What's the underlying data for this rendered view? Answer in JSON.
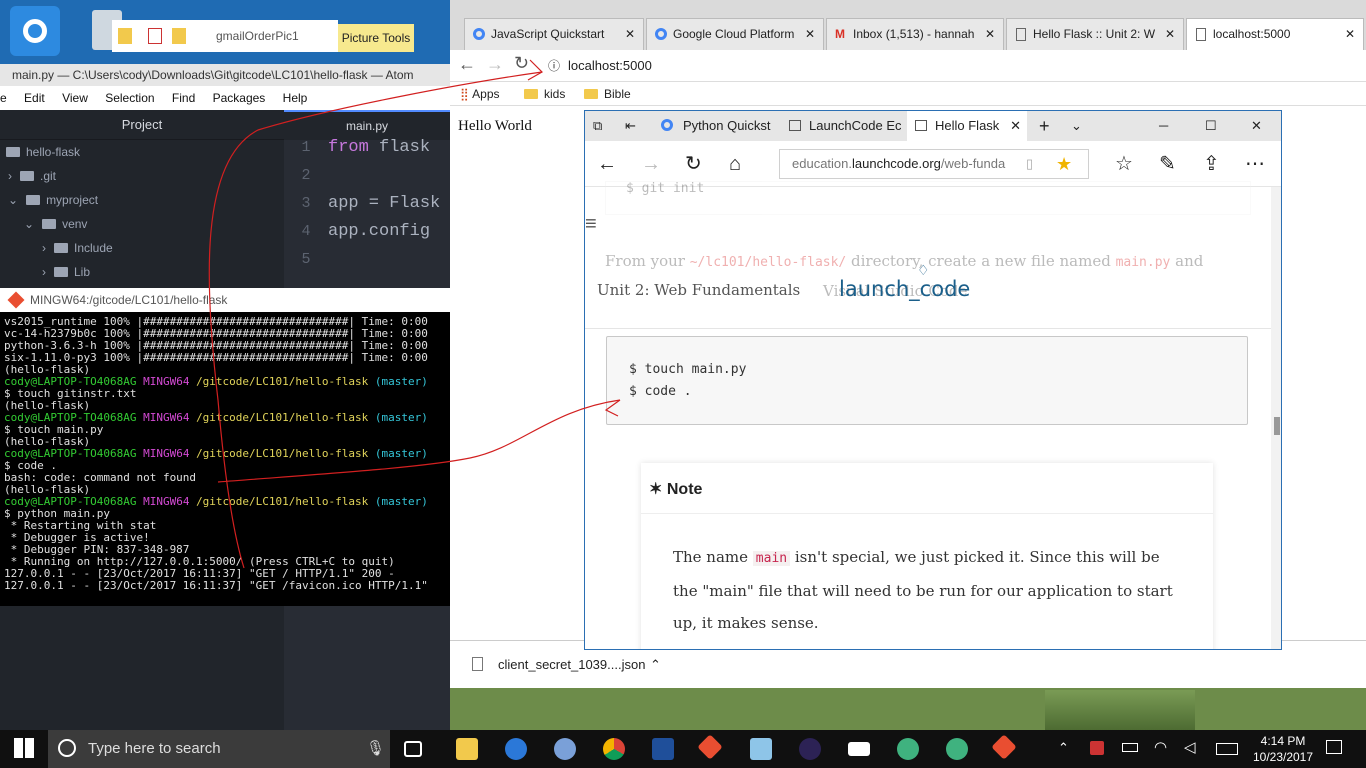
{
  "desktop": {
    "picture_tools": "Picture Tools",
    "file_label": "gmailOrderPic1"
  },
  "atom": {
    "title": "main.py — C:\\Users\\cody\\Downloads\\Git\\gitcode\\LC101\\hello-flask — Atom",
    "menu": [
      "e",
      "Edit",
      "View",
      "Selection",
      "Find",
      "Packages",
      "Help"
    ],
    "tree_header": "Project",
    "tree": [
      "hello-flask",
      ".git",
      "myproject",
      "venv",
      "Include",
      "Lib"
    ],
    "tab": "main.py",
    "code": [
      {
        "ln": "1",
        "kw": "from",
        "text": " flask"
      },
      {
        "ln": "2",
        "kw": "",
        "text": ""
      },
      {
        "ln": "3",
        "kw": "",
        "text": "app = Flask"
      },
      {
        "ln": "4",
        "kw": "",
        "text": "app.config"
      },
      {
        "ln": "5",
        "kw": "",
        "text": ""
      }
    ]
  },
  "terminal": {
    "title": "MINGW64:/gitcode/LC101/hello-flask",
    "pkg1": "vs2015_runtime 100% |###############################| Time: 0:00",
    "pkg2": "vc-14-h2379b0c 100% |###############################| Time: 0:00",
    "pkg3": "python-3.6.3-h 100% |###############################| Time: 0:00",
    "pkg4": "six-1.11.0-py3 100% |###############################| Time: 0:00",
    "env": "(hello-flask)",
    "user": "cody@LAPTOP-TO4068AG",
    "shell": "MINGW64",
    "path": "/gitcode/LC101/hello-flask",
    "branch": "(master)",
    "cmd1": "$ touch gitinstr.txt",
    "cmd2": "$ touch main.py",
    "cmd3": "$ code .",
    "err": "bash: code: command not found",
    "cmd4": "$ python main.py",
    "out1": " * Restarting with stat",
    "out2": " * Debugger is active!",
    "out3": " * Debugger PIN: 837-348-987",
    "out4": " * Running on http://127.0.0.1:5000/ (Press CTRL+C to quit)",
    "log1": "127.0.0.1 - - [23/Oct/2017 16:11:37] \"GET / HTTP/1.1\" 200 -",
    "log2": "127.0.0.1 - - [23/Oct/2017 16:11:37] \"GET /favicon.ico HTTP/1.1\""
  },
  "chrome": {
    "tabs": [
      "JavaScript Quickstart",
      "Google Cloud Platform",
      "Inbox (1,513) - hannah",
      "Hello Flask :: Unit 2: W",
      "localhost:5000"
    ],
    "url": "localhost:5000",
    "bookmarks": [
      "Apps",
      "kids",
      "Bible"
    ],
    "body_text": "Hello World",
    "download": "client_secret_1039....json"
  },
  "edge": {
    "tabs": [
      "Python Quickst",
      "LaunchCode Ec",
      "Hello Flask"
    ],
    "url_prefix": "education.",
    "url_host": "launchcode.org",
    "url_rest": "/web-funda",
    "faded_prefix": "From your ",
    "faded_path": "~/lc101/hello-flask/",
    "faded_mid": " directory, create a new file named ",
    "faded_file": "main.py",
    "faded_and": " and",
    "faded_line2": "Visual Studio Code",
    "faded_code": "$ git init",
    "unit": "Unit 2: Web Fundamentals",
    "logo": "launch_code",
    "code1": "$ touch main.py",
    "code2": "$ code .",
    "note_title": "Note",
    "note_p1a": "The name ",
    "note_code": "main",
    "note_p1b": " isn't special, we just picked it. Since this will be",
    "note_p2": "the \"main\" file that will need to be run for our application to start",
    "note_p3": "up, it makes sense."
  },
  "taskbar": {
    "search": "Type here to search",
    "time": "4:14 PM",
    "date": "10/23/2017"
  },
  "colors": {
    "accent": "#2b6fb3",
    "logo": "#1b5f8a",
    "annotation": "#d22020"
  }
}
